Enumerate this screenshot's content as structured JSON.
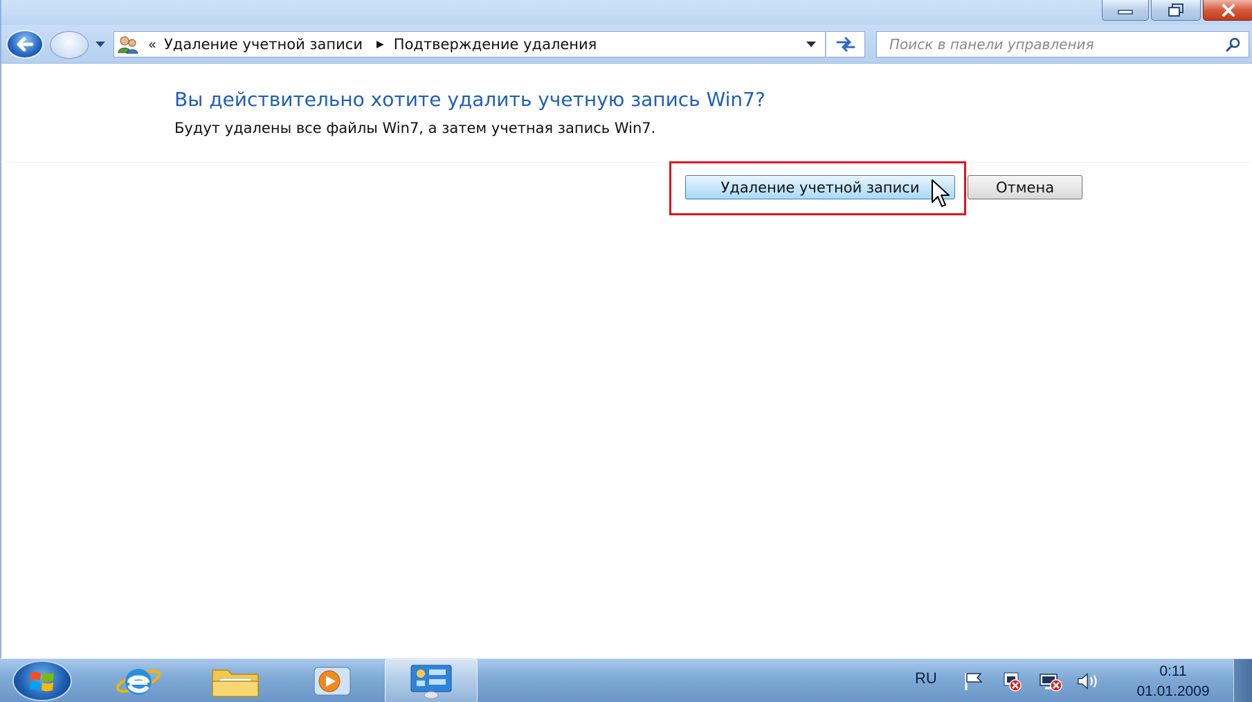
{
  "window": {
    "caption_buttons": [
      "minimize-icon",
      "restore-icon",
      "close-icon"
    ]
  },
  "nav": {
    "address": {
      "chevrons": "«",
      "breadcrumbs": [
        "Удаление учетной записи",
        "Подтверждение удаления"
      ]
    },
    "search": {
      "placeholder": "Поиск в панели управления"
    }
  },
  "content": {
    "heading": "Вы действительно хотите удалить учетную запись Win7?",
    "subtext": "Будут удалены все файлы Win7, а затем учетная запись Win7.",
    "buttons": {
      "delete": "Удаление учетной записи",
      "cancel": "Отмена"
    }
  },
  "taskbar": {
    "apps": [
      "start-orb",
      "internet-explorer",
      "windows-explorer",
      "media-player",
      "control-panel"
    ],
    "active_app": "control-panel",
    "language": "RU",
    "clock": {
      "time": "0:11",
      "date": "01.01.2009"
    }
  },
  "colors": {
    "heading_blue": "#1e5fb8",
    "highlight_red": "#e0141e",
    "taskbar_blue": "#7fa9d6"
  }
}
